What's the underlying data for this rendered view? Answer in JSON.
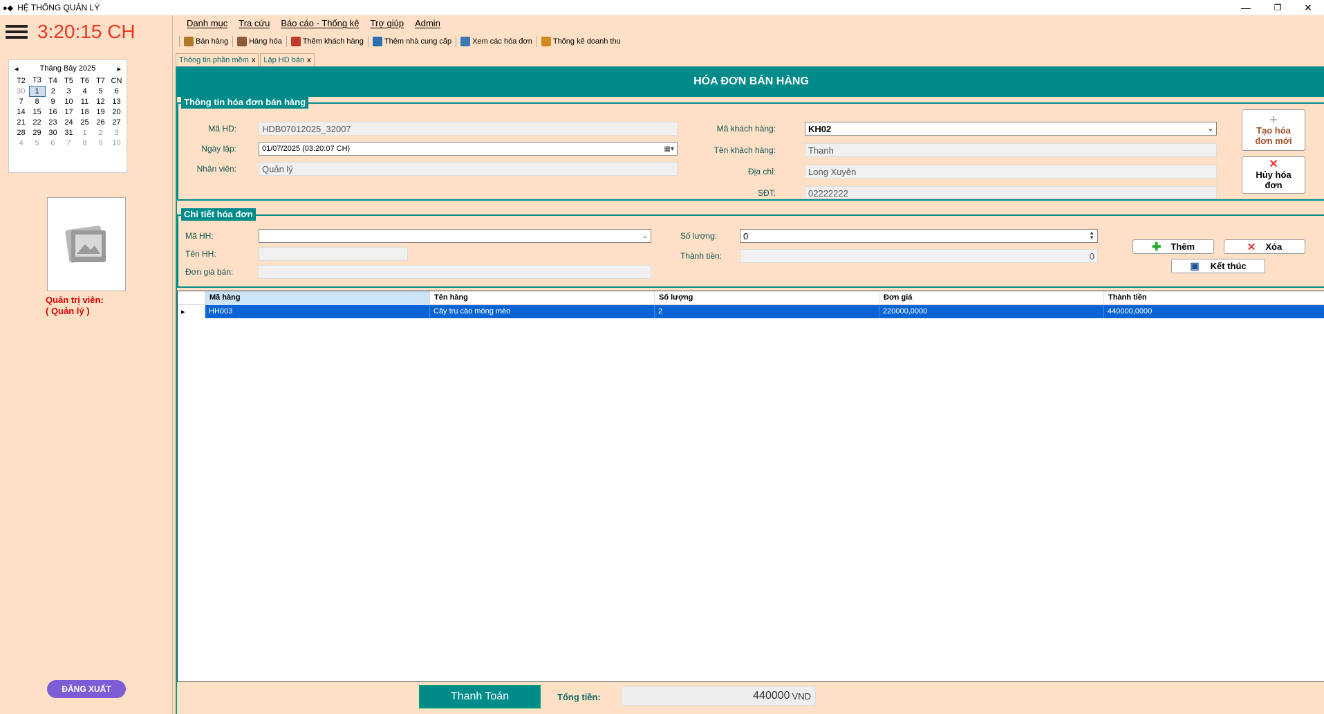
{
  "window": {
    "title": "HỆ THỐNG QUẢN LÝ",
    "minimize": "—",
    "restore": "❐",
    "close": "✕"
  },
  "left": {
    "clock": "3:20:15 CH",
    "calendar": {
      "month_label": "Tháng Bảy 2025",
      "weekdays": [
        "T2",
        "T3",
        "T4",
        "T5",
        "T6",
        "T7",
        "CN"
      ],
      "weeks": [
        [
          "30",
          "1",
          "2",
          "3",
          "4",
          "5",
          "6"
        ],
        [
          "7",
          "8",
          "9",
          "10",
          "11",
          "12",
          "13"
        ],
        [
          "14",
          "15",
          "16",
          "17",
          "18",
          "19",
          "20"
        ],
        [
          "21",
          "22",
          "23",
          "24",
          "25",
          "26",
          "27"
        ],
        [
          "28",
          "29",
          "30",
          "31",
          "1",
          "2",
          "3"
        ],
        [
          "4",
          "5",
          "6",
          "7",
          "8",
          "9",
          "10"
        ]
      ]
    },
    "admin_role": "Quản trị viên:",
    "admin_name": "( Quản lý )",
    "logout_label": "ĐĂNG XUẤT"
  },
  "menu": [
    "Danh mục",
    "Tra cứu",
    "Báo cáo - Thống kê",
    "Trợ giúp",
    "Admin"
  ],
  "toolbar": [
    {
      "label": "Bán hàng",
      "icon": "cart-icon",
      "color": "#b07a2a"
    },
    {
      "label": "Hàng hóa",
      "icon": "goods-icon",
      "color": "#8a5a3a"
    },
    {
      "label": "Thêm khách hàng",
      "icon": "add-customer-icon",
      "color": "#c0392b"
    },
    {
      "label": "Thêm nhà cung cấp",
      "icon": "supplier-icon",
      "color": "#2c6fb0"
    },
    {
      "label": "Xem các hóa đơn",
      "icon": "invoice-icon",
      "color": "#3a7ab8"
    },
    {
      "label": "Thống kê doanh thu",
      "icon": "chart-icon",
      "color": "#d08a20"
    }
  ],
  "tabs": [
    {
      "label": "Thông tin phần mềm",
      "close": "x"
    },
    {
      "label": "Lập HD bán",
      "close": "x"
    }
  ],
  "banner_title": "HÓA ĐƠN BÁN HÀNG",
  "invoice": {
    "group_title": "Thông tin hóa đơn bán hàng",
    "code_label": "Mã HD:",
    "code_value": "HDB07012025_32007",
    "date_label": "Ngày lập:",
    "date_value": "01/07/2025 (03:20:07 CH)",
    "staff_label": "Nhân viên:",
    "staff_value": "Quản lý",
    "cust_code_label": "Mã khách hàng:",
    "cust_code_value": "KH02",
    "cust_name_label": "Tên khách hàng:",
    "cust_name_value": "Thanh",
    "address_label": "Địa chỉ:",
    "address_value": "Long Xuyên",
    "phone_label": "SĐT:",
    "phone_value": "02222222",
    "new_btn": "Tạo hóa đơn mới",
    "cancel_btn": "Hủy hóa đơn"
  },
  "detail": {
    "group_title": "Chi tiết hóa đơn",
    "item_code_label": "Mã HH:",
    "item_code_value": "",
    "item_name_label": "Tên HH:",
    "item_name_value": "",
    "price_label": "Đơn giá bán:",
    "price_value": "",
    "qty_label": "Số lượng:",
    "qty_value": "0",
    "subtotal_label": "Thành tiền:",
    "subtotal_value": "0",
    "add_btn": "Thêm",
    "delete_btn": "Xóa",
    "finish_btn": "Kết thúc"
  },
  "grid": {
    "columns": [
      "Mã hàng",
      "Tên hàng",
      "Số lượng",
      "Đơn giá",
      "Thành tiền"
    ],
    "rows": [
      [
        "HH003",
        "Cây trụ cào móng mèo",
        "2",
        "220000,0000",
        "440000,0000"
      ]
    ]
  },
  "footer": {
    "pay_btn": "Thanh Toán",
    "total_label": "Tổng tiền:",
    "total_value": "440000",
    "total_unit": "VND"
  }
}
